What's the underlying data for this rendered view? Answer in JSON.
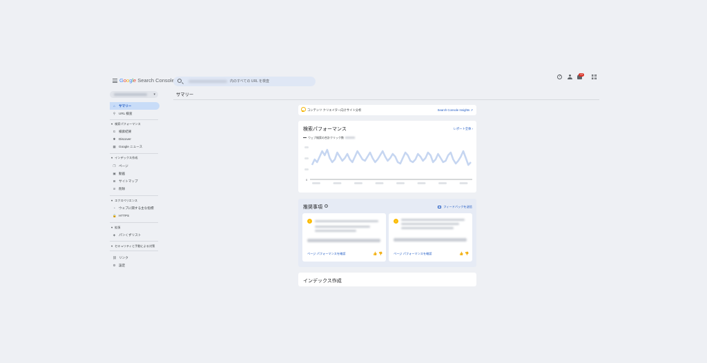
{
  "app": {
    "logo": {
      "g": "G",
      "o1": "o",
      "o2": "o",
      "g2": "g",
      "l": "l",
      "e": "e",
      "rest": " Search Console"
    }
  },
  "topbar": {
    "search_placeholder": "内のすべての URL を検査",
    "notification_count": "13",
    "help_glyph": "?"
  },
  "sidebar": {
    "property_caret": "▾",
    "items": [
      {
        "label": "サマリー",
        "icon": "home-icon",
        "glyph": "⌂"
      },
      {
        "label": "URL 検査",
        "icon": "search-icon",
        "glyph": "⚲"
      }
    ],
    "sections": [
      {
        "label": "検索パフォーマンス",
        "items": [
          {
            "label": "検索結果",
            "icon": "google-g-icon",
            "glyph": "G"
          },
          {
            "label": "Discover",
            "icon": "discover-icon",
            "glyph": "✱"
          },
          {
            "label": "Google ニュース",
            "icon": "news-icon",
            "glyph": "▦"
          }
        ]
      },
      {
        "label": "インデックス作成",
        "items": [
          {
            "label": "ページ",
            "icon": "pages-icon",
            "glyph": "❐"
          },
          {
            "label": "動画",
            "icon": "video-icon",
            "glyph": "▣"
          },
          {
            "label": "サイトマップ",
            "icon": "sitemap-icon",
            "glyph": "⊞"
          },
          {
            "label": "削除",
            "icon": "removal-icon",
            "glyph": "⊘"
          }
        ]
      },
      {
        "label": "エクスペリエンス",
        "items": [
          {
            "label": "ウェブに関する主な指標",
            "icon": "gauge-icon",
            "glyph": "◔"
          },
          {
            "label": "HTTPS",
            "icon": "lock-icon",
            "glyph": "🔒"
          }
        ]
      },
      {
        "label": "拡張",
        "items": [
          {
            "label": "パンくずリスト",
            "icon": "breadcrumb-icon",
            "glyph": "◈"
          }
        ]
      },
      {
        "label": "セキュリティと手動による対策",
        "items": []
      }
    ],
    "bottom_items": [
      {
        "label": "リンク",
        "icon": "links-icon",
        "glyph": "⛓"
      },
      {
        "label": "設定",
        "icon": "settings-icon",
        "glyph": "⚙"
      }
    ],
    "section_caret": "▾"
  },
  "main": {
    "title": "サマリー",
    "tip": {
      "text": "コンテンツ クリエイター向けサイト分析",
      "link": "Search Console Insights ↗"
    },
    "performance": {
      "title": "検索パフォーマンス",
      "report_link": "レポート全体  ›",
      "legend": "ウェブ検索の合計クリック数",
      "y_axis_zero": "0"
    },
    "recommendations": {
      "title": "推奨事項",
      "info_glyph": "?",
      "feedback_link": "フィードバックを送信",
      "cards": [
        {
          "link": "ページ パフォーマンスを確認",
          "dot": "!"
        },
        {
          "link": "ページ パフォーマンスを確認",
          "dot": "!"
        }
      ]
    },
    "index": {
      "title": "インデックス作成"
    }
  },
  "colors": {
    "accent": "#1a56c2",
    "active_bg": "#c8dcf8",
    "page_bg": "#eef0f4",
    "chart_line": "#c6d6f1",
    "badge": "#d93025",
    "tip_icon": "#f4b400"
  },
  "chart_data": {
    "type": "line",
    "title": "",
    "series": [
      {
        "name": "ウェブ検索の合計クリック数",
        "values": [
          10,
          14,
          12,
          16,
          20,
          17,
          21,
          15,
          12,
          14,
          19,
          16,
          13,
          15,
          18,
          14,
          12,
          16,
          20,
          17,
          14,
          13,
          16,
          19,
          15,
          12,
          14,
          17,
          20,
          16,
          13,
          15,
          18,
          16,
          12,
          11,
          15,
          19,
          17,
          13,
          12,
          14,
          18,
          16,
          13,
          15,
          19,
          17,
          12,
          14,
          18,
          15,
          12,
          13,
          17,
          19,
          14,
          11,
          13,
          16,
          20,
          15,
          10,
          12
        ]
      }
    ],
    "grid": false
  }
}
